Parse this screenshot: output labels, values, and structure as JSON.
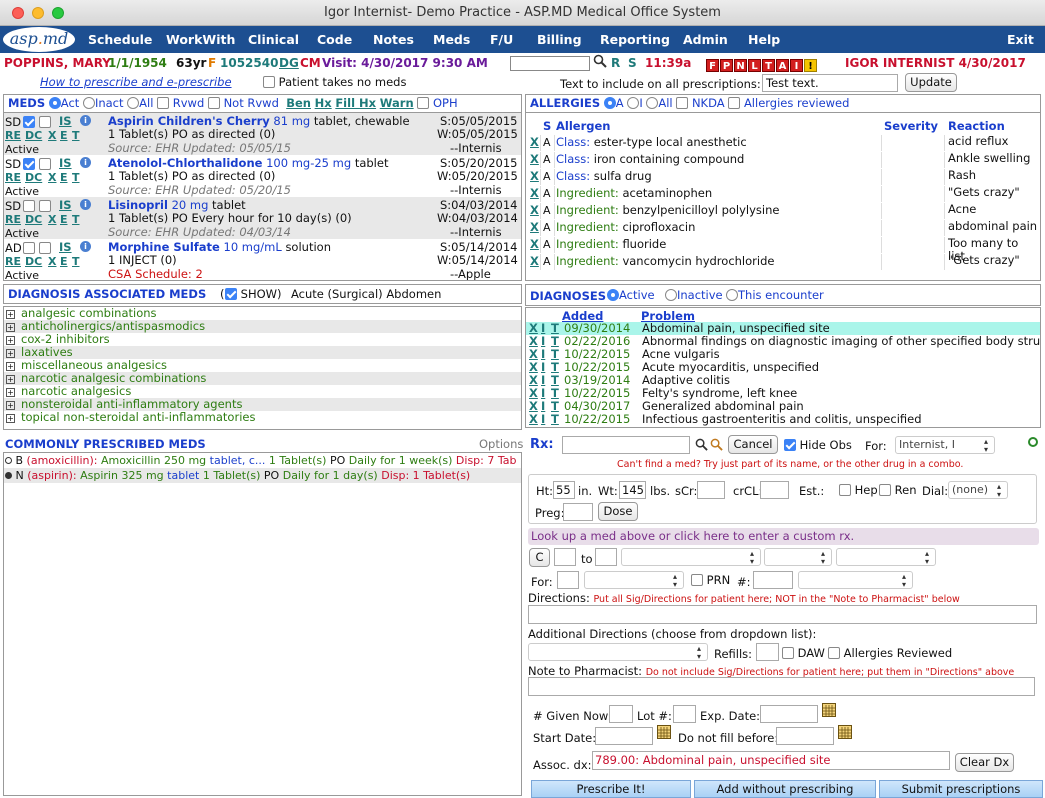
{
  "window": {
    "title": "Igor Internist- Demo Practice - ASP.MD Medical Office System"
  },
  "logo": {
    "left": "asp",
    "o": ".",
    "right": "md"
  },
  "nav": [
    "Schedule",
    "WorkWith",
    "Clinical",
    "Code",
    "Notes",
    "Meds",
    "F/U",
    "Billing",
    "Reporting",
    "Admin",
    "Help",
    "Exit"
  ],
  "patient": {
    "name": "POPPINS, MARY",
    "dob": "1/1/1954",
    "age": "63yr",
    "sex": "F",
    "id": "1052540",
    "dg": "DG",
    "cm": "CM",
    "visit": "Visit: 4/30/2017 9:30 AM",
    "r": "R",
    "s": "S",
    "time": "11:39a",
    "flags": [
      "F",
      "P",
      "N",
      "L",
      "T",
      "A",
      "I"
    ],
    "warn": "!",
    "provider": "IGOR INTERNIST 4/30/2017"
  },
  "toprow": {
    "howto": "How to prescribe and e-prescribe",
    "no_meds": "Patient takes no meds",
    "text_label": "Text to include on all prescriptions:",
    "text_value": "Test text.",
    "update": "Update"
  },
  "meds": {
    "title": "MEDS",
    "filters": [
      "Act",
      "Inact",
      "All"
    ],
    "checks": [
      "Rvwd",
      "Not Rvwd"
    ],
    "links": [
      "Ben",
      "Hx",
      "Fill",
      "Hx",
      "Warn"
    ],
    "oph": "OPH",
    "items": [
      {
        "tag": "SD",
        "name": "Aspirin Children's Cherry",
        "dose": "81 mg",
        "form": "tablet, chewable",
        "sig": "1 Tablet(s) PO as directed (0)",
        "source": "Source: EHR Updated: 05/05/15",
        "status": "Active",
        "s": "S:05/05/2015",
        "w": "W:05/05/2015",
        "by": "--Internis"
      },
      {
        "tag": "SD",
        "name": "Atenolol-Chlorthalidone",
        "dose": "100 mg-25 mg",
        "form": "tablet",
        "sig": "1 Tablet(s) PO as directed (0)",
        "source": "Source: EHR Updated: 05/20/15",
        "status": "Active",
        "s": "S:05/20/2015",
        "w": "W:05/20/2015",
        "by": "--Internis"
      },
      {
        "tag": "SD",
        "name": "Lisinopril",
        "dose": "20 mg",
        "form": "tablet",
        "sig": "1 Tablet(s) PO Every hour for 10 day(s) (0)",
        "source": "Source: EHR Updated: 04/03/14",
        "status": "Active",
        "s": "S:04/03/2014",
        "w": "W:04/03/2014",
        "by": "--Internis"
      },
      {
        "tag": "AD",
        "name": "Morphine Sulfate",
        "dose": "10 mg/mL",
        "form": "solution",
        "sig": "1 INJECT (0)",
        "source": "CSA Schedule: 2",
        "status": "Active",
        "s": "S:05/14/2014",
        "w": "W:05/14/2014",
        "by": "--Apple"
      }
    ],
    "actions": [
      "IS",
      "RE",
      "DC",
      "X",
      "E",
      "T"
    ]
  },
  "allergies": {
    "title": "ALLERGIES",
    "filters": [
      "A",
      "I",
      "All"
    ],
    "nkda": "NKDA",
    "reviewed": "Allergies reviewed",
    "col_s": "S",
    "col_allergy": "Allergen",
    "col_severity": "Severity",
    "col_reaction": "Reaction",
    "items": [
      {
        "kind": "Class:",
        "name": "ester-type local anesthetic",
        "reaction": "acid reflux"
      },
      {
        "kind": "Class:",
        "name": "iron containing compound",
        "reaction": "Ankle swelling"
      },
      {
        "kind": "Class:",
        "name": "sulfa drug",
        "reaction": "Rash"
      },
      {
        "kind": "Ingredient:",
        "name": "acetaminophen",
        "reaction": "\"Gets crazy\""
      },
      {
        "kind": "Ingredient:",
        "name": "benzylpenicilloyl polylysine",
        "reaction": "Acne"
      },
      {
        "kind": "Ingredient:",
        "name": "ciprofloxacin",
        "reaction": "abdominal pain"
      },
      {
        "kind": "Ingredient:",
        "name": "fluoride",
        "reaction": "Too many to list"
      },
      {
        "kind": "Ingredient:",
        "name": "vancomycin hydrochloride",
        "reaction": "\"Gets crazy\""
      }
    ]
  },
  "dxmeds": {
    "title": "DIAGNOSIS ASSOCIATED MEDS",
    "show": "SHOW)",
    "dx": "Acute (Surgical) Abdomen",
    "items": [
      "analgesic combinations",
      "anticholinergics/antispasmodics",
      "cox-2 inhibitors",
      "laxatives",
      "miscellaneous analgesics",
      "narcotic analgesic combinations",
      "narcotic analgesics",
      "nonsteroidal anti-inflammatory agents",
      "topical non-steroidal anti-inflammatories"
    ]
  },
  "diagnoses": {
    "title": "DIAGNOSES",
    "filters": [
      "Active",
      "Inactive",
      "This encounter"
    ],
    "col_added": "Added",
    "col_problem": "Problem",
    "items": [
      {
        "date": "09/30/2014",
        "problem": "Abdominal pain, unspecified site"
      },
      {
        "date": "02/22/2016",
        "problem": "Abnormal findings on diagnostic imaging of other specified body structures"
      },
      {
        "date": "10/22/2015",
        "problem": "Acne vulgaris"
      },
      {
        "date": "10/22/2015",
        "problem": "Acute myocarditis, unspecified"
      },
      {
        "date": "03/19/2014",
        "problem": "Adaptive colitis"
      },
      {
        "date": "10/22/2015",
        "problem": "Felty's syndrome, left knee"
      },
      {
        "date": "04/30/2017",
        "problem": "Generalized abdominal pain"
      },
      {
        "date": "10/22/2015",
        "problem": "Infectious gastroenteritis and colitis, unspecified"
      }
    ]
  },
  "common": {
    "title": "COMMONLY PRESCRIBED MEDS",
    "options": "Options",
    "items": [
      {
        "code": "B",
        "generic": "(amoxicillin):",
        "name": "Amoxicillin",
        "dose": "250 mg",
        "form": "tablet, c...",
        "qty": "1 Tablet(s)",
        "route": "PO",
        "freq": "Daily for 1 week(s)",
        "disp": "Disp: 7 Tab"
      },
      {
        "code": "N",
        "generic": "(aspirin):",
        "name": "Aspirin",
        "dose": "325 mg",
        "form": "tablet",
        "qty": "1 Tablet(s)",
        "route": "PO",
        "freq": "Daily for 1 day(s)",
        "disp": "Disp: 1 Tablet(s)"
      }
    ]
  },
  "rx": {
    "label": "Rx:",
    "cancel": "Cancel",
    "hide_obs": "Hide Obs",
    "for_label": "For:",
    "for_value": "Internist, I",
    "hint": "Can't find a med? Try just part of its name, or the other drug in a combo.",
    "ht_label": "Ht:",
    "ht": "55",
    "in": "in.",
    "wt_label": "Wt:",
    "wt": "145",
    "lbs": "lbs.",
    "scr": "sCr:",
    "crcl": "crCL:",
    "est": "Est.:",
    "hep": "Hep",
    "ren": "Ren",
    "dial": "Dial:",
    "dial_value": "(none)",
    "preg": "Preg:",
    "dose": "Dose",
    "lookup": "Look up a med above or click here to enter a custom rx.",
    "c": "C",
    "to": "to",
    "for2": "For:",
    "prn": "PRN",
    "hash": "#:",
    "directions": "Directions:",
    "dir_note": "Put all Sig/Directions for patient here; NOT in the \"Note to Pharmacist\" below",
    "addl": "Additional Directions (choose from dropdown list):",
    "refills": "Refills:",
    "daw": "DAW",
    "allergies_reviewed": "Allergies Reviewed",
    "note": "Note to Pharmacist:",
    "note_hint": "Do not include Sig/Directions for patient here; put them in \"Directions\" above",
    "given": "# Given Now:",
    "lot": "Lot #:",
    "exp": "Exp. Date:",
    "start": "Start Date:",
    "nofill": "Do not fill before:",
    "assoc": "Assoc. dx:",
    "assoc_value": "789.00: Abdominal pain, unspecified site",
    "clear": "Clear Dx",
    "prescribe": "Prescribe It!",
    "add_without": "Add without prescribing",
    "submit": "Submit prescriptions"
  }
}
